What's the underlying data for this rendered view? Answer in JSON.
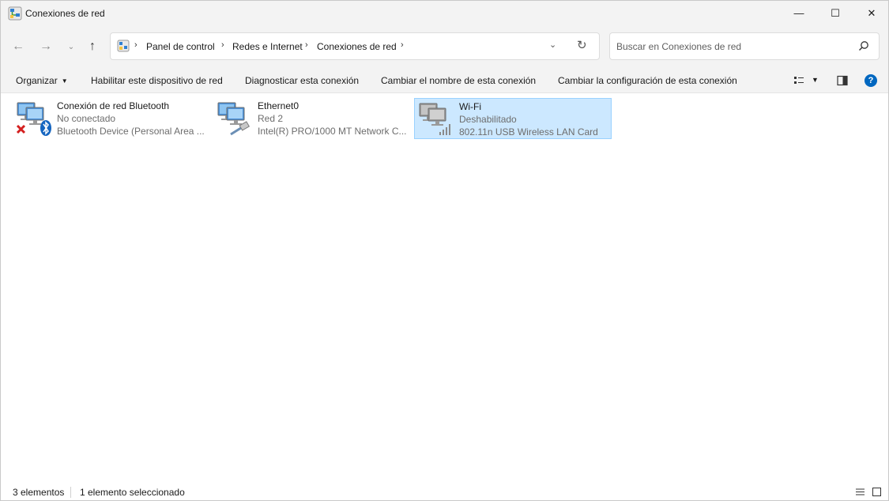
{
  "window": {
    "title": "Conexiones de red",
    "minimize_glyph": "—",
    "maximize_glyph": "☐",
    "close_glyph": "✕"
  },
  "nav": {
    "back_glyph": "←",
    "forward_glyph": "→",
    "recent_glyph": "⌄",
    "up_glyph": "↑"
  },
  "address": {
    "breadcrumbs": [
      "Panel de control",
      "Redes e Internet",
      "Conexiones de red"
    ],
    "separator": "›",
    "dropdown_glyph": "⌄",
    "refresh_glyph": "↻"
  },
  "search": {
    "placeholder": "Buscar en Conexiones de red",
    "value": ""
  },
  "commands": {
    "organize": "Organizar",
    "enable": "Habilitar este dispositivo de red",
    "diagnose": "Diagnosticar esta conexión",
    "rename": "Cambiar el nombre de esta conexión",
    "settings": "Cambiar la configuración de esta conexión",
    "caret": "▼",
    "help": "?"
  },
  "connections": [
    {
      "name": "Conexión de red Bluetooth",
      "status": "No conectado",
      "device": "Bluetooth Device (Personal Area ...",
      "icon": "bluetooth-network-icon",
      "selected": false
    },
    {
      "name": "Ethernet0",
      "status": "Red 2",
      "device": "Intel(R) PRO/1000 MT Network C...",
      "icon": "ethernet-network-icon",
      "selected": false
    },
    {
      "name": "Wi-Fi",
      "status": "Deshabilitado",
      "device": "802.11n USB Wireless LAN Card",
      "icon": "wifi-network-icon",
      "selected": true
    }
  ],
  "status": {
    "count": "3 elementos",
    "selection": "1 elemento seleccionado"
  },
  "colors": {
    "accent": "#0067c0",
    "selection_bg": "#cce8ff",
    "selection_border": "#99d1ff"
  }
}
